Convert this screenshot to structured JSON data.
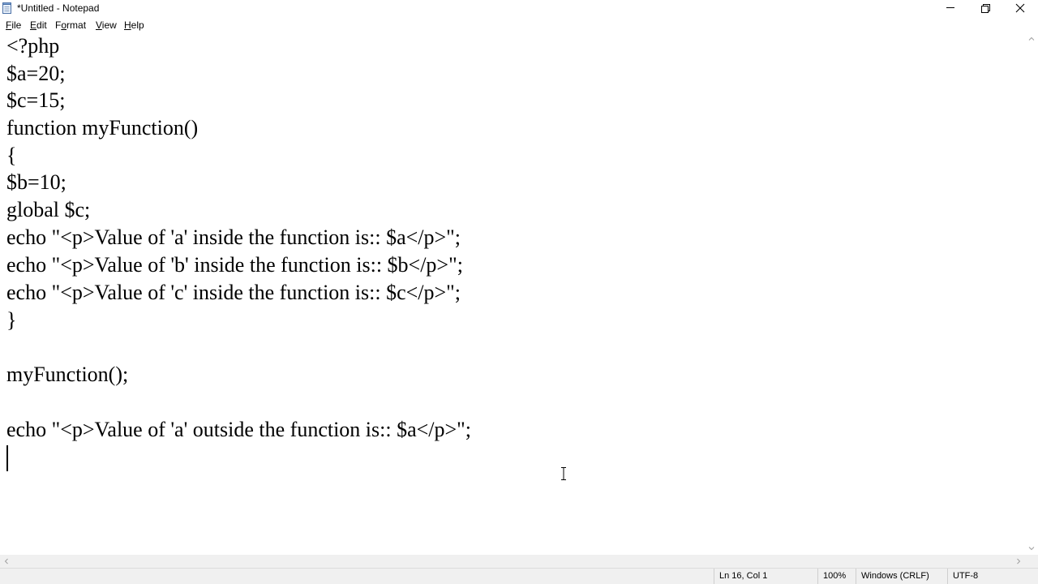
{
  "window": {
    "title": "*Untitled - Notepad",
    "icon": "notepad-icon",
    "caption_buttons": [
      "minimize-icon",
      "restore-icon",
      "close-icon"
    ]
  },
  "menu": {
    "items": [
      "File",
      "Edit",
      "Format",
      "View",
      "Help"
    ]
  },
  "editor": {
    "lines": [
      "<?php",
      "$a=20;",
      "$c=15;",
      "function myFunction()",
      "{",
      "$b=10;",
      "global $c;",
      "echo \"<p>Value of 'a' inside the function is:: $a</p>\";",
      "echo \"<p>Value of 'b' inside the function is:: $b</p>\";",
      "echo \"<p>Value of 'c' inside the function is:: $c</p>\";",
      "}",
      "",
      "myFunction();",
      "",
      "echo \"<p>Value of 'a' outside the function is:: $a</p>\";",
      ""
    ]
  },
  "statusbar": {
    "position": "Ln 16, Col 1",
    "zoom": "100%",
    "line_ending": "Windows (CRLF)",
    "encoding": "UTF-8"
  }
}
